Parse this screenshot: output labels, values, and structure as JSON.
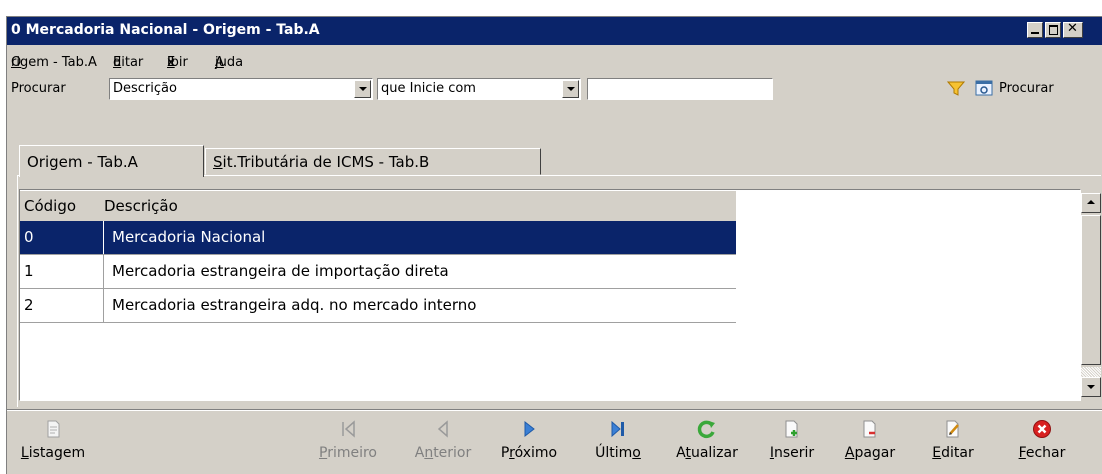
{
  "window": {
    "title": "0 Mercadoria Nacional -  Origem - Tab.A",
    "colors": {
      "titlebar": "#0a246a",
      "face": "#d4d0c8",
      "selection": "#0a246a"
    }
  },
  "menu": {
    "items": [
      {
        "pre": "",
        "key": "O",
        "post": "rigem - Tab.A"
      },
      {
        "pre": "",
        "key": "E",
        "post": "ditar"
      },
      {
        "pre": "E",
        "key": "x",
        "post": "ibir"
      },
      {
        "pre": "",
        "key": "A",
        "post": "juda"
      }
    ]
  },
  "search": {
    "label": "Procurar",
    "field_value": "Descrição",
    "condition_value": "que Inicie com",
    "text_value": "",
    "button_label": "Procurar",
    "filter_icon": "funnel-icon",
    "search_icon": "search-window-icon"
  },
  "tabs": [
    {
      "label": "Origem - Tab.A",
      "active": true
    },
    {
      "label_key": "S",
      "label_rest": "it.Tributária de ICMS - Tab.B",
      "active": false
    }
  ],
  "table": {
    "columns": [
      "Código",
      "Descrição"
    ],
    "rows": [
      {
        "code": "0",
        "desc": "Mercadoria Nacional",
        "selected": true
      },
      {
        "code": "1",
        "desc": "Mercadoria estrangeira de importação direta",
        "selected": false
      },
      {
        "code": "2",
        "desc": "Mercadoria estrangeira adq. no mercado interno",
        "selected": false
      }
    ]
  },
  "toolbar": {
    "listagem": {
      "key": "L",
      "rest": "istagem",
      "icon": "document-icon",
      "enabled": true
    },
    "primeiro": {
      "key": "P",
      "rest": "rimeiro",
      "icon": "first-icon",
      "enabled": false
    },
    "anterior": {
      "pre": "A",
      "key": "n",
      "rest": "terior",
      "icon": "previous-icon",
      "enabled": false
    },
    "proximo": {
      "pre": "P",
      "key": "r",
      "rest": "óximo",
      "icon": "next-icon",
      "enabled": true
    },
    "ultimo": {
      "pre": "Últim",
      "key": "o",
      "rest": "",
      "icon": "last-icon",
      "enabled": true
    },
    "atualizar": {
      "pre": "A",
      "key": "t",
      "rest": "ualizar",
      "icon": "refresh-icon",
      "enabled": true
    },
    "inserir": {
      "key": "I",
      "rest": "nserir",
      "icon": "insert-icon",
      "enabled": true
    },
    "apagar": {
      "key": "A",
      "rest": "pagar",
      "icon": "delete-icon",
      "enabled": true
    },
    "editar": {
      "key": "E",
      "rest": "ditar",
      "icon": "edit-icon",
      "enabled": true
    },
    "fechar": {
      "key": "F",
      "rest": "echar",
      "icon": "close-red-icon",
      "enabled": true
    }
  }
}
